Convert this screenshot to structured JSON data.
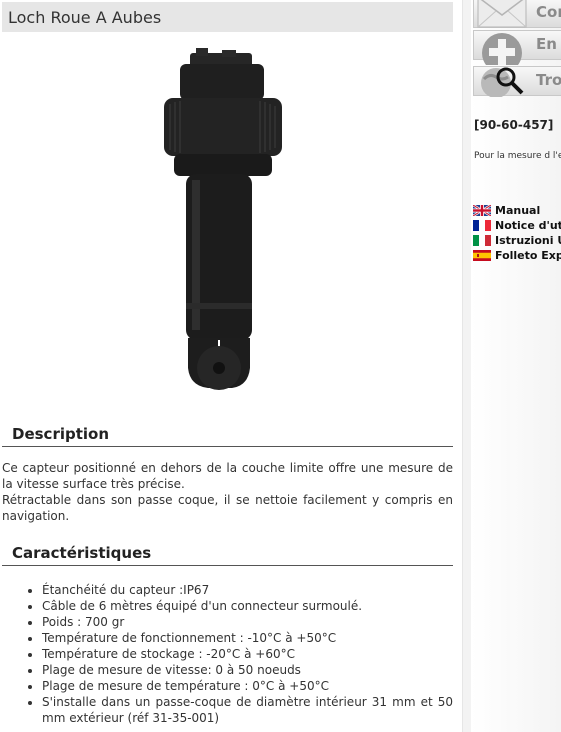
{
  "product": {
    "title": "Loch Roue A Aubes"
  },
  "description": {
    "heading": "Description",
    "paragraph1": "Ce capteur positionné en dehors de la couche limite offre une mesure de la vitesse surface très précise.",
    "paragraph2": "Rétractable dans son passe coque, il se nettoie facilement y compris en navigation."
  },
  "specs": {
    "heading": "Caractéristiques",
    "items": [
      "Étanchéité du capteur :IP67",
      "Câble de 6 mètres équipé d'un connecteur surmoulé.",
      "Poids : 700 gr",
      "Température de fonctionnement : -10°C à +50°C",
      "Température de stockage : -20°C à +60°C",
      "Plage de mesure de vitesse: 0 à 50 noeuds",
      "Plage de mesure de température : 0°C à +50°C",
      "S'installe dans un passe-coque de diamètre intérieur 31 mm et 50 mm extérieur (réf 31-35-001)"
    ]
  },
  "sidebar": {
    "buttons": [
      {
        "label": "Cor",
        "icon": "envelope-icon"
      },
      {
        "label": "En",
        "icon": "plus-icon"
      },
      {
        "label": "Tro",
        "icon": "magnifier-globe-icon"
      }
    ],
    "reference": "[90-60-457]",
    "usage": "Pour la mesure d l'eau",
    "manuals": [
      {
        "label": "Manual",
        "flag": "uk-flag-icon"
      },
      {
        "label": "Notice d'util",
        "flag": "france-flag-icon"
      },
      {
        "label": "Istruzioni Ut",
        "flag": "italy-flag-icon"
      },
      {
        "label": "Folleto Expli",
        "flag": "spain-flag-icon"
      }
    ]
  },
  "colors": {
    "title_bar": "#e6e6e6",
    "sensor_body": "#1c1c1c",
    "sidebar_button_text": "#8a8a8a"
  }
}
